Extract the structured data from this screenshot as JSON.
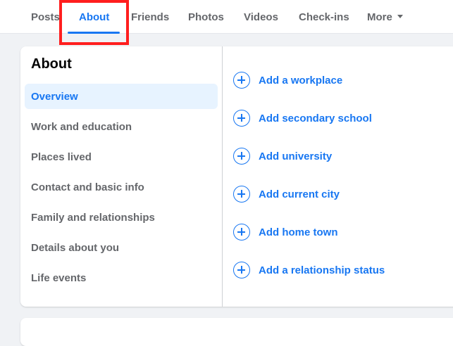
{
  "tabs": [
    {
      "label": "Posts"
    },
    {
      "label": "About"
    },
    {
      "label": "Friends"
    },
    {
      "label": "Photos"
    },
    {
      "label": "Videos"
    },
    {
      "label": "Check-ins"
    },
    {
      "label": "More"
    }
  ],
  "active_tab": "About",
  "about": {
    "title": "About",
    "nav": [
      {
        "label": "Overview"
      },
      {
        "label": "Work and education"
      },
      {
        "label": "Places lived"
      },
      {
        "label": "Contact and basic info"
      },
      {
        "label": "Family and relationships"
      },
      {
        "label": "Details about you"
      },
      {
        "label": "Life events"
      }
    ],
    "selected_nav": "Overview",
    "add_items": [
      {
        "label": "Add a workplace"
      },
      {
        "label": "Add secondary school"
      },
      {
        "label": "Add university"
      },
      {
        "label": "Add current city"
      },
      {
        "label": "Add home town"
      },
      {
        "label": "Add a relationship status"
      }
    ]
  },
  "colors": {
    "accent": "#1877f2",
    "highlight": "#ff1e1e",
    "selected_bg": "#e7f3ff"
  }
}
